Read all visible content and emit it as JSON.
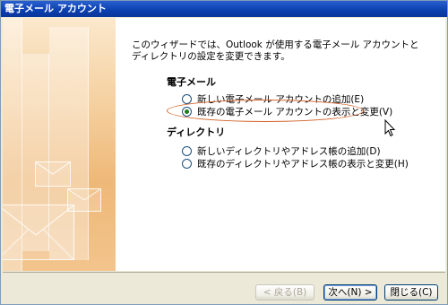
{
  "window": {
    "title": "電子メール アカウント"
  },
  "intro": {
    "text": "このウィザードでは、Outlook が使用する電子メール アカウントとディレクトリの設定を変更できます。"
  },
  "email_section": {
    "title": "電子メール",
    "options": [
      {
        "label": "新しい電子メール アカウントの追加(E)",
        "checked": false
      },
      {
        "label": "既存の電子メール アカウントの表示と変更(V)",
        "checked": true
      }
    ]
  },
  "directory_section": {
    "title": "ディレクトリ",
    "options": [
      {
        "label": "新しいディレクトリやアドレス帳の追加(D)",
        "checked": false
      },
      {
        "label": "既存のディレクトリやアドレス帳の表示と変更(H)",
        "checked": false
      }
    ]
  },
  "buttons": {
    "back": "< 戻る(B)",
    "next": "次へ(N) >",
    "close": "閉じる(C)"
  },
  "colors": {
    "title_bar": "#0a3fb0",
    "highlight": "#d3632a",
    "radio_dot": "#1a7d1a"
  }
}
